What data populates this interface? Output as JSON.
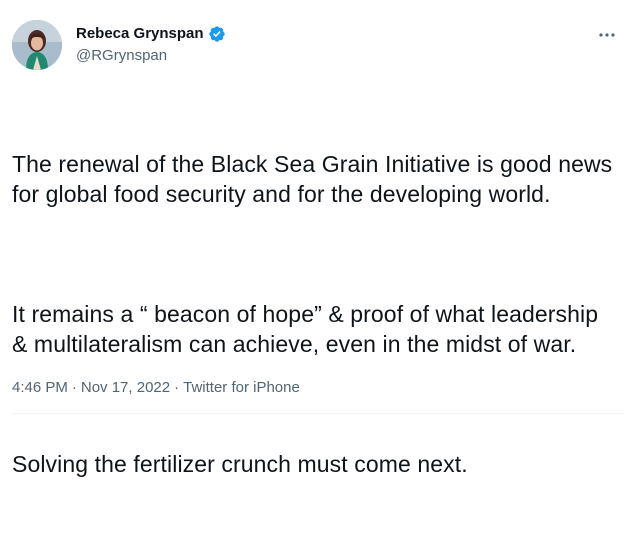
{
  "author": {
    "display_name": "Rebeca Grynspan",
    "handle": "@RGrynspan",
    "verified": true,
    "avatar_icon": "profile-photo"
  },
  "tweet": {
    "paragraphs": [
      "The renewal of the Black Sea Grain Initiative is good news for global food security and for the developing world.",
      "It remains a “ beacon of hope” & proof of what leadership  & multilateralism can achieve, even in the midst of war.",
      "Solving the fertilizer crunch must come next."
    ]
  },
  "meta": {
    "time": "4:46 PM",
    "date": "Nov 17, 2022",
    "source": "Twitter for iPhone",
    "separator": "·"
  },
  "icons": {
    "verified": "verified-badge-icon",
    "more": "more-options-icon"
  },
  "colors": {
    "verified_blue": "#1d9bf0",
    "text_primary": "#0f1419",
    "text_secondary": "#536471"
  }
}
